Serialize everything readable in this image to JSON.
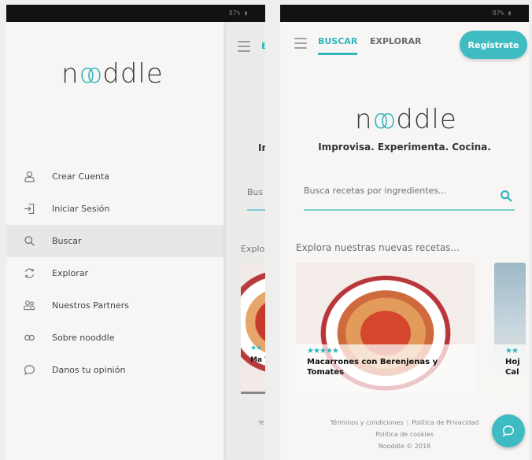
{
  "status": {
    "left_phone": "87% ▮",
    "right_phone": "87% ▮"
  },
  "brand": {
    "logo_prefix": "n",
    "logo_oo": "oo",
    "logo_suffix": "ddle",
    "accent": "#2fb5bc"
  },
  "drawer": {
    "items": [
      {
        "label": "Crear Cuenta",
        "icon": "user-icon"
      },
      {
        "label": "Iniciar Sesión",
        "icon": "login-icon"
      },
      {
        "label": "Buscar",
        "icon": "search-icon",
        "active": true
      },
      {
        "label": "Explorar",
        "icon": "explore-icon"
      },
      {
        "label": "Nuestros Partners",
        "icon": "partners-icon"
      },
      {
        "label": "Sobre nooddle",
        "icon": "infinity-icon"
      },
      {
        "label": "Danos tu opinión",
        "icon": "chat-icon"
      }
    ],
    "behind": {
      "tab": "B",
      "tagline": "Ir",
      "search": "Bus",
      "explora": "Explo",
      "card_caption": "Ma To",
      "footer": "Té"
    }
  },
  "main": {
    "tabs": [
      {
        "label": "BUSCAR"
      },
      {
        "label": "EXPLORAR"
      }
    ],
    "register_label": "Regístrate",
    "tagline": "Improvisa. Experimenta. Cocina.",
    "search": {
      "placeholder": "Busca recetas por ingredientes..."
    },
    "section_title": "Explora nuestras nuevas recetas...",
    "cards": [
      {
        "title": "Macarrones con Berenjenas y Tomates",
        "stars": "★★★★★"
      },
      {
        "title": "Hoj Cal",
        "stars": "★★"
      }
    ]
  },
  "footer": {
    "terms": "Términos y condiciones",
    "privacy": "Política de Privacidad",
    "cookies": "Política de cookies",
    "copyright": "Nooddle © 2018"
  }
}
